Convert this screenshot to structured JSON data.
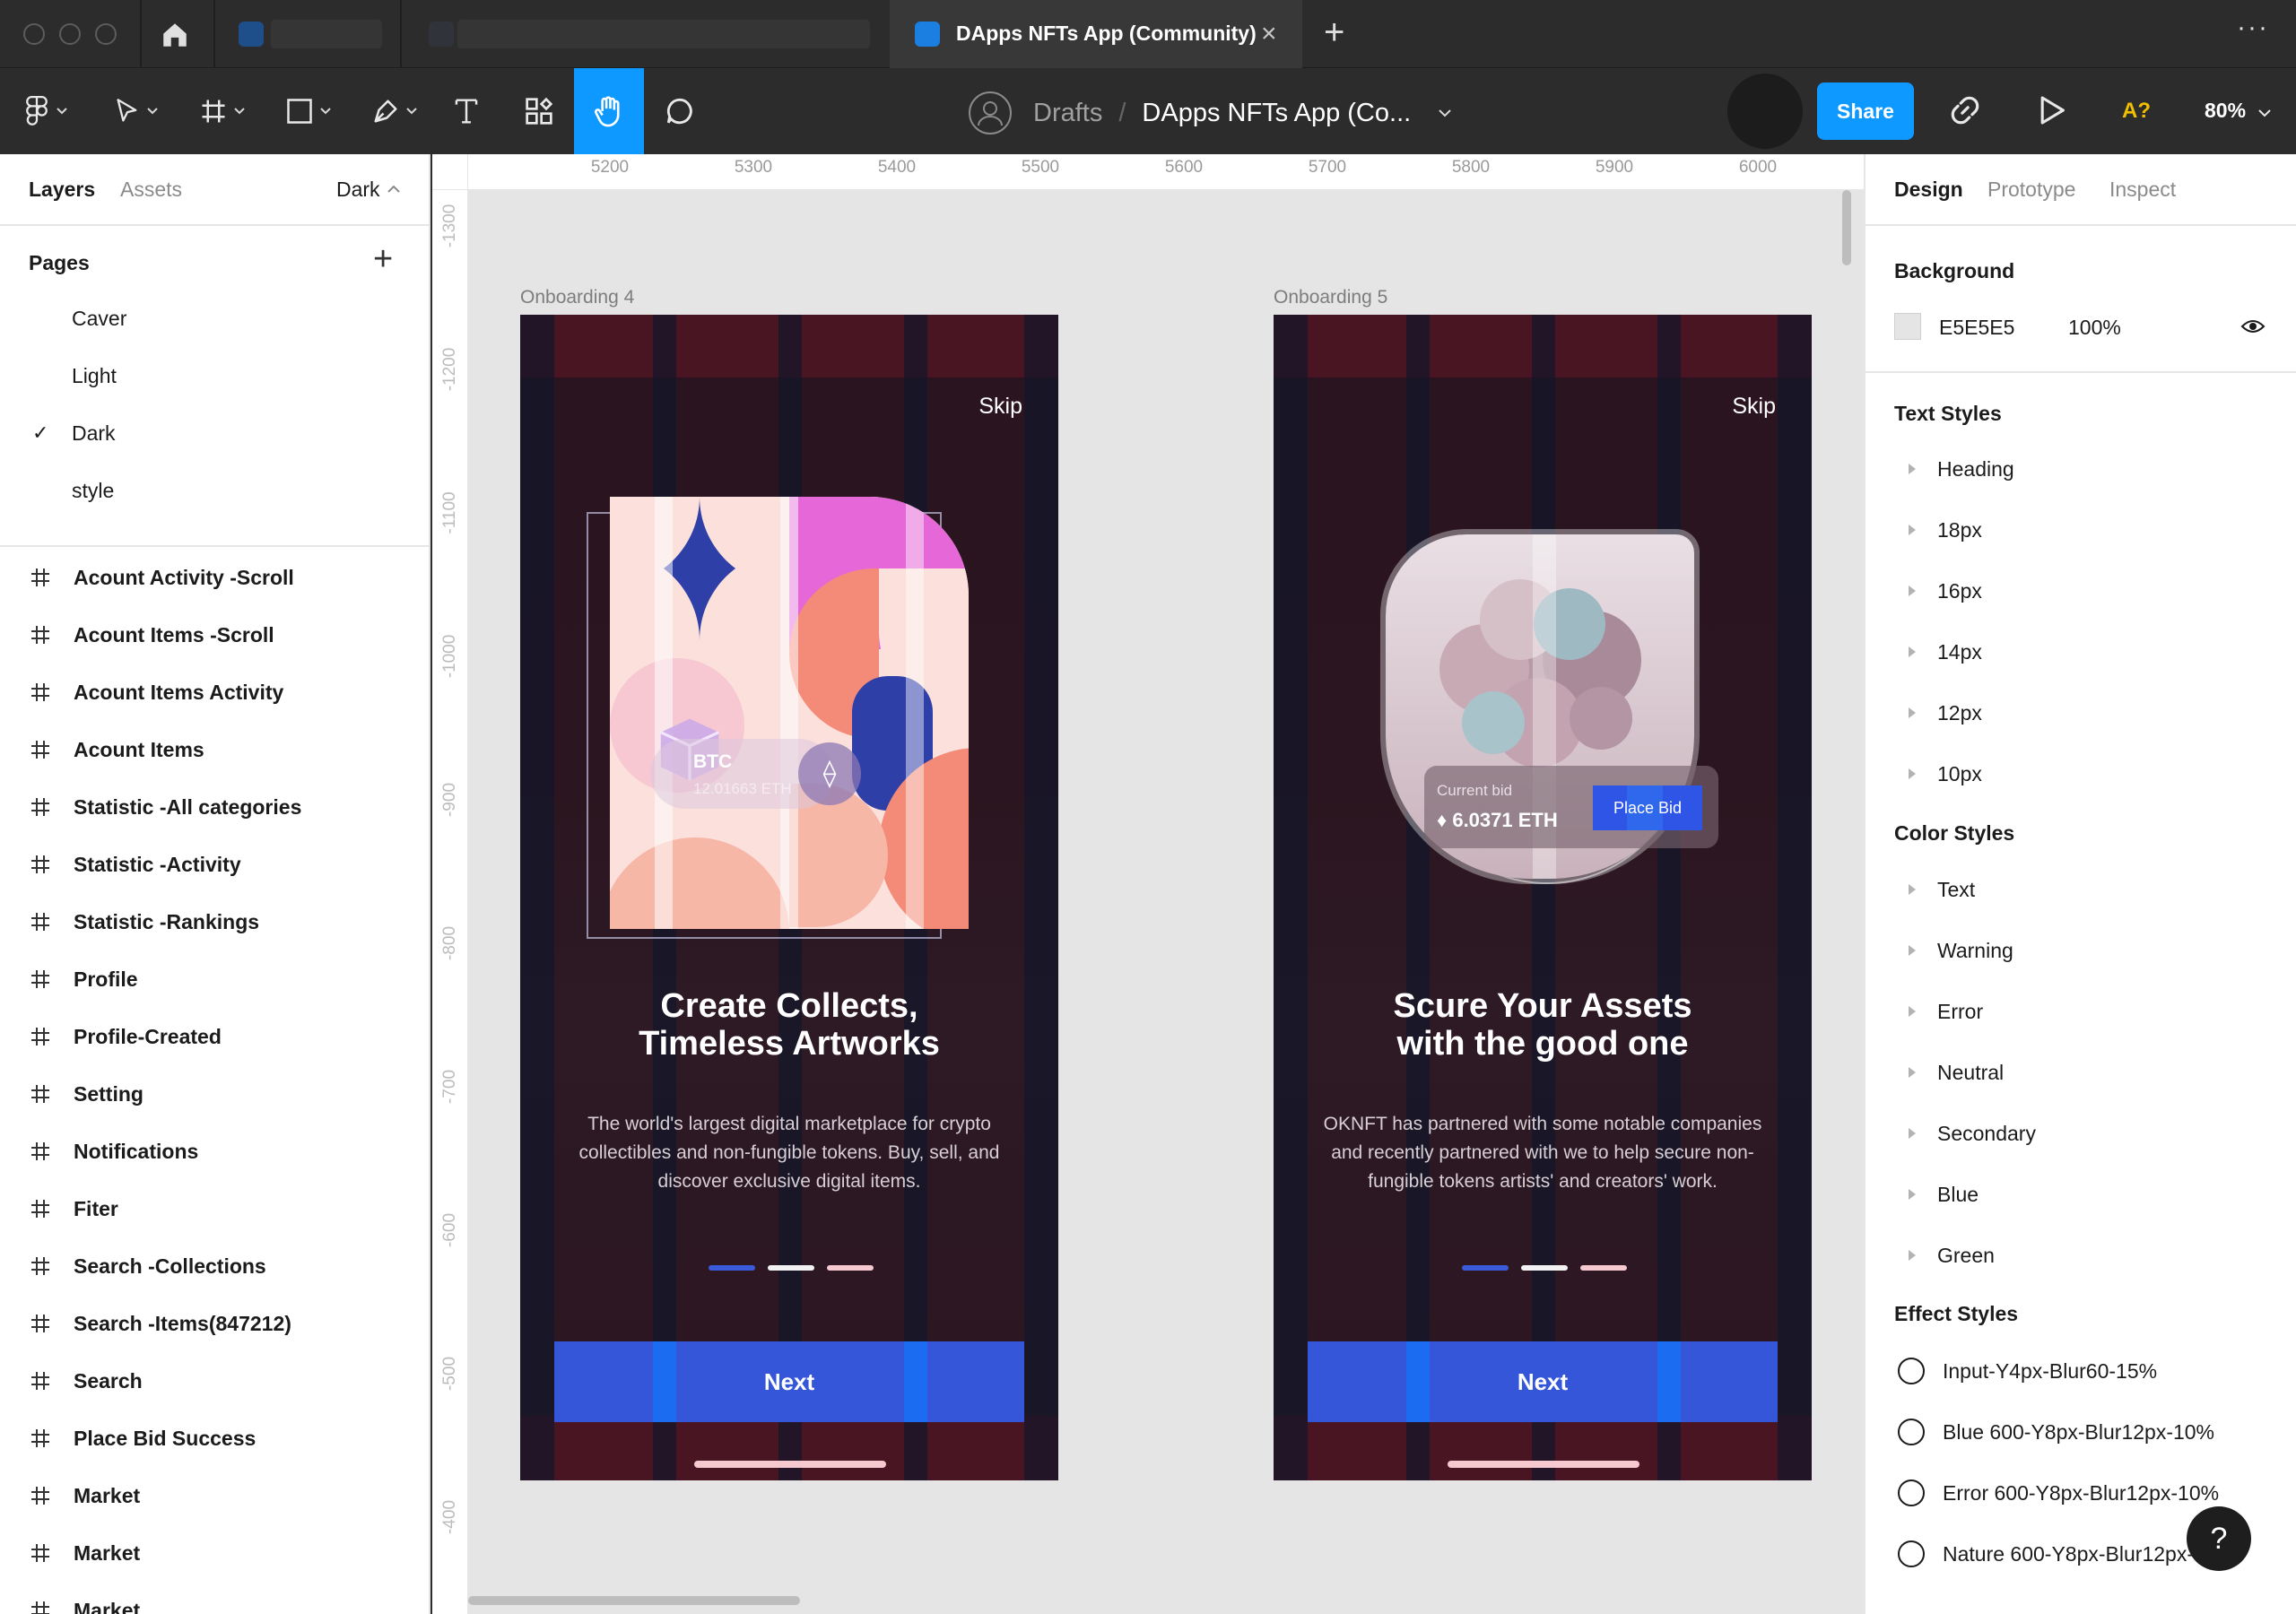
{
  "tabs": {
    "active_title": "DApps NFTs App (Community)"
  },
  "toolbar": {
    "breadcrumb_drafts": "Drafts",
    "breadcrumb_slash": "/",
    "file_name": "DApps NFTs App (Co...",
    "share_label": "Share",
    "accessibility_label": "A?",
    "zoom": "80%"
  },
  "left_panel": {
    "tab_layers": "Layers",
    "tab_assets": "Assets",
    "page_selector": "Dark",
    "pages_heading": "Pages",
    "pages": [
      {
        "label": "Caver",
        "selected": false
      },
      {
        "label": "Light",
        "selected": false
      },
      {
        "label": "Dark",
        "selected": true
      },
      {
        "label": "style",
        "selected": false
      }
    ],
    "check_mark": "✓",
    "layers": [
      "Acount Activity -Scroll",
      "Acount Items -Scroll",
      "Acount Items Activity",
      "Acount Items",
      "Statistic -All categories",
      "Statistic -Activity",
      "Statistic -Rankings",
      "Profile",
      "Profile-Created",
      "Setting",
      "Notifications",
      "Fiter",
      "Search -Collections",
      "Search -Items(847212)",
      "Search",
      "Place Bid Success",
      "Market",
      "Market",
      "Market"
    ]
  },
  "canvas": {
    "background": "#E5E5E5",
    "ruler_x": [
      "5200",
      "5300",
      "5400",
      "5500",
      "5600",
      "5700",
      "5800",
      "5900",
      "6000"
    ],
    "ruler_y": [
      "-1300",
      "-1200",
      "-1100",
      "-1000",
      "-900",
      "-800",
      "-700",
      "-600",
      "-500",
      "-400"
    ],
    "frames": [
      {
        "label": "Onboarding 4",
        "skip": "Skip",
        "heading": "Create Collects,\nTimeless Artworks",
        "body": "The world's largest digital marketplace for crypto collectibles and non-fungible tokens. Buy, sell, and discover exclusive digital items.",
        "button": "Next",
        "card_name": "BTC",
        "card_value": "12.01663 ETH",
        "eth_symbol": "⟠"
      },
      {
        "label": "Onboarding 5",
        "skip": "Skip",
        "heading": "Scure Your Assets\nwith the good one",
        "body": "OKNFT has partnered with some notable companies and recently partnered with we to help secure non-fungible tokens artists' and creators' work.",
        "button": "Next",
        "bid_label": "Current bid",
        "bid_value": "♦ 6.0371 ETH",
        "bid_button": "Place Bid"
      }
    ]
  },
  "right_panel": {
    "tab_design": "Design",
    "tab_prototype": "Prototype",
    "tab_inspect": "Inspect",
    "background_heading": "Background",
    "background_hex": "E5E5E5",
    "background_opacity": "100%",
    "text_styles_heading": "Text Styles",
    "text_styles": [
      "Heading",
      "18px",
      "16px",
      "14px",
      "12px",
      "10px"
    ],
    "color_styles_heading": "Color Styles",
    "color_styles": [
      "Text",
      "Warning",
      "Error",
      "Neutral",
      "Secondary",
      "Blue",
      "Green"
    ],
    "effect_styles_heading": "Effect Styles",
    "effect_styles": [
      "Input-Y4px-Blur60-15%",
      "Blue 600-Y8px-Blur12px-10%",
      "Error 600-Y8px-Blur12px-10%",
      "Nature 600-Y8px-Blur12px-"
    ],
    "help": "?"
  },
  "colors": {
    "accent": "#0D99FF",
    "cta": "#3556D8",
    "frame_band": "#4A1522"
  }
}
